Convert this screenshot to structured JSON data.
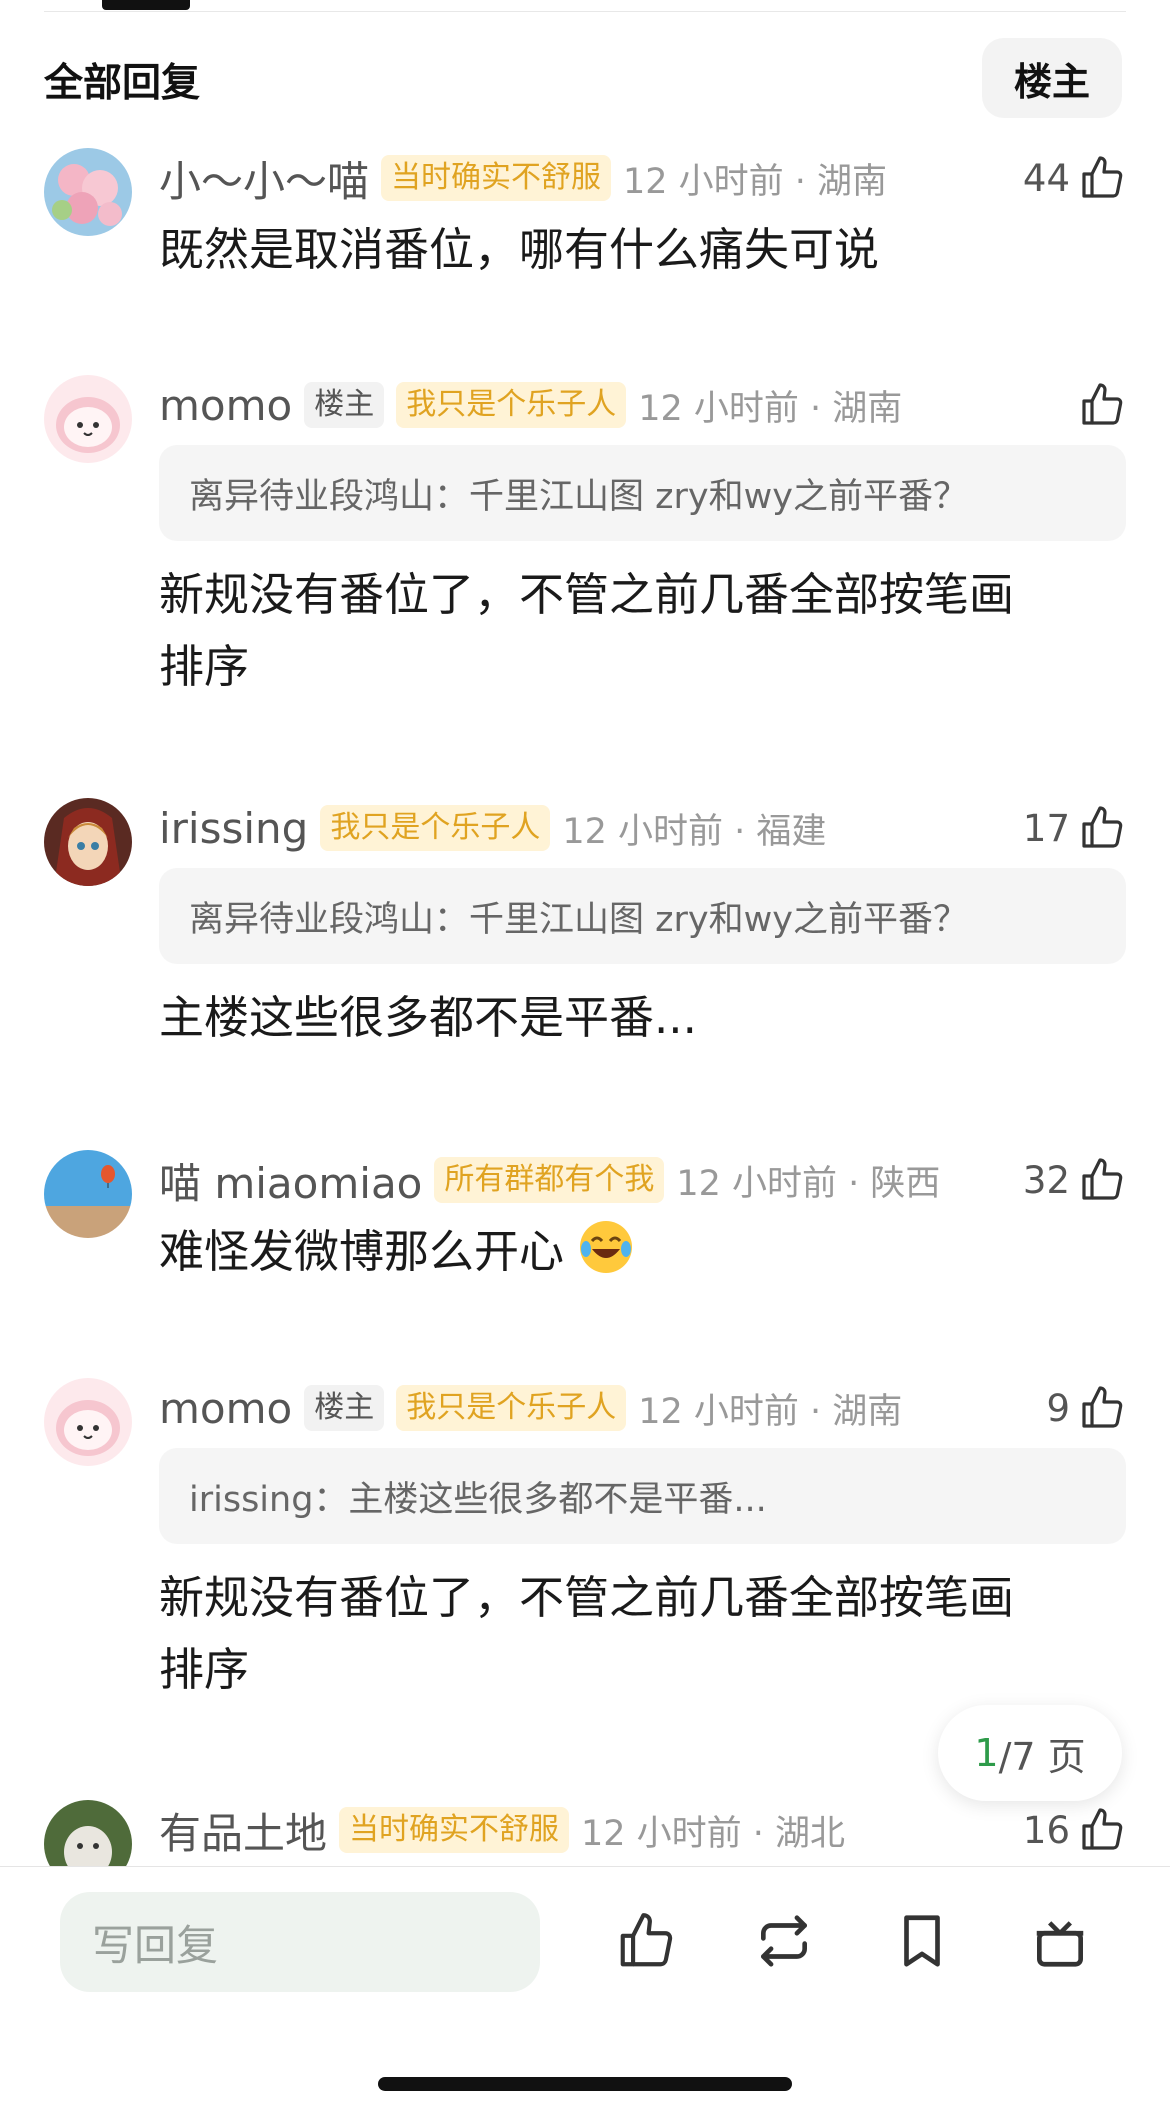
{
  "header": {
    "title": "全部回复",
    "filter_label": "楼主"
  },
  "comments": [
    {
      "username": "小～小～喵",
      "is_op": false,
      "fan_badge": "当时确实不舒服",
      "time_loc": "12 小时前 · 湖南",
      "likes": "44",
      "quote": null,
      "text": "既然是取消番位，哪有什么痛失可说"
    },
    {
      "username": "momo",
      "is_op": true,
      "op_badge": "楼主",
      "fan_badge": "我只是个乐子人",
      "time_loc": "12 小时前 · 湖南",
      "likes": "",
      "quote": "离异待业段鸿山：千里江山图 zry和wy之前平番？",
      "text_line1": "新规没有番位了，不管之前几番全部按笔画",
      "text_line2": "排序"
    },
    {
      "username": "irissing",
      "is_op": false,
      "fan_badge": "我只是个乐子人",
      "time_loc": "12 小时前 · 福建",
      "likes": "17",
      "quote": "离异待业段鸿山：千里江山图 zry和wy之前平番？",
      "text": "主楼这些很多都不是平番..."
    },
    {
      "username": "喵 miaomiao",
      "is_op": false,
      "fan_badge": "所有群都有个我",
      "time_loc": "12 小时前 · 陕西",
      "likes": "32",
      "quote": null,
      "text": "难怪发微博那么开心"
    },
    {
      "username": "momo",
      "is_op": true,
      "op_badge": "楼主",
      "fan_badge": "我只是个乐子人",
      "time_loc": "12 小时前 · 湖南",
      "likes": "9",
      "quote": "irissing：主楼这些很多都不是平番...",
      "text_line1": "新规没有番位了，不管之前几番全部按笔画",
      "text_line2": "排序"
    },
    {
      "username": "有品土地",
      "is_op": false,
      "fan_badge": "当时确实不舒服",
      "time_loc": "12 小时前 · 湖北",
      "likes": "16",
      "quote": null,
      "text": ""
    }
  ],
  "pagination": {
    "current": "1",
    "total": "/7 页"
  },
  "bottom_bar": {
    "reply_placeholder": "写回复"
  },
  "icons": [
    "thumbs-up-icon",
    "repost-icon",
    "bookmark-icon",
    "gift-icon",
    "laughing-tears-emoji"
  ],
  "colors": {
    "fan_badge_bg": "#fff3d6",
    "fan_badge_text": "#e0a321",
    "page_current": "#2e9b4a"
  }
}
